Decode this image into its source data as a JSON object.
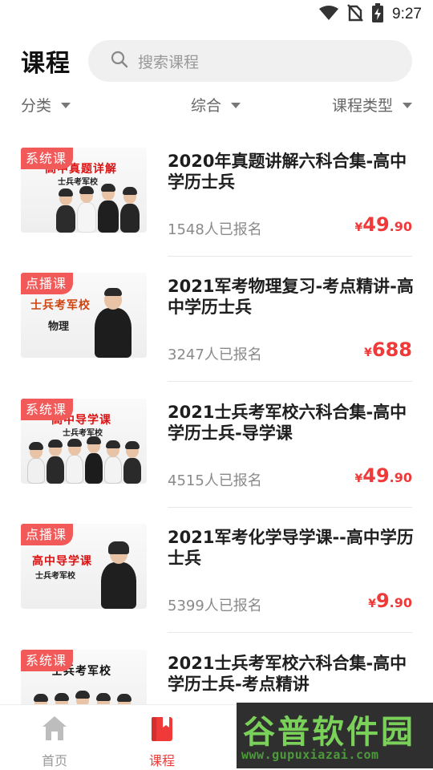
{
  "status_bar": {
    "time": "9:27",
    "icons": [
      "wifi-icon",
      "no-sim-icon",
      "battery-charging-icon"
    ]
  },
  "header": {
    "title": "课程",
    "search": {
      "placeholder": "搜索课程",
      "icon": "search-icon"
    }
  },
  "filters": {
    "category": "分类",
    "sort": "综合",
    "type": "课程类型"
  },
  "courses": [
    {
      "tag": "系统课",
      "title": "2020年真题讲解六科合集-高中学历士兵",
      "enrolled": "1548人已报名",
      "price_currency": "¥",
      "price_int": "49",
      "price_dec": ".90",
      "thumb_headline": "高中真题详解",
      "thumb_sub": "士兵考军校"
    },
    {
      "tag": "点播课",
      "title": "2021军考物理复习-考点精讲-高中学历士兵",
      "enrolled": "3247人已报名",
      "price_currency": "¥",
      "price_int": "688",
      "price_dec": "",
      "thumb_headline": "士兵考军校",
      "thumb_sub": "物理"
    },
    {
      "tag": "系统课",
      "title": "2021士兵考军校六科合集-高中学历士兵-导学课",
      "enrolled": "4515人已报名",
      "price_currency": "¥",
      "price_int": "49",
      "price_dec": ".90",
      "thumb_headline": "高中导学课",
      "thumb_sub": "士兵考军校"
    },
    {
      "tag": "点播课",
      "title": "2021军考化学导学课--高中学历士兵",
      "enrolled": "5399人已报名",
      "price_currency": "¥",
      "price_int": "9",
      "price_dec": ".90",
      "thumb_headline": "高中导学课",
      "thumb_sub": "士兵考军校"
    },
    {
      "tag": "系统课",
      "title": "2021士兵考军校六科合集-高中学历士兵-考点精讲",
      "enrolled": "",
      "price_currency": "",
      "price_int": "",
      "price_dec": "",
      "thumb_headline": "士兵考军校",
      "thumb_sub": ""
    }
  ],
  "bottom_nav": {
    "home": {
      "label": "首页",
      "icon": "home-icon"
    },
    "course": {
      "label": "课程",
      "icon": "bookmark-book-icon"
    }
  },
  "watermark": {
    "title": "谷普软件园",
    "url": "www.gupuxiazai.com"
  },
  "colors": {
    "accent": "#f03a3a",
    "tag": "#f25a5a",
    "search_bg": "#f0f0f0"
  }
}
